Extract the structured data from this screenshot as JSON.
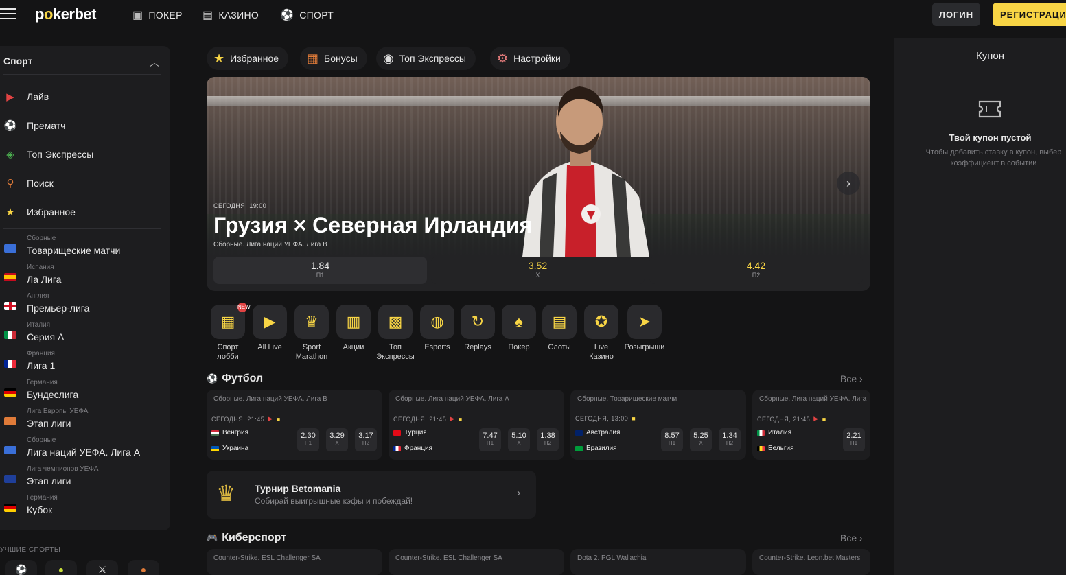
{
  "header": {
    "logo": "pokerbet",
    "nav": [
      {
        "label": "ПОКЕР",
        "icon": "poker-chip-icon"
      },
      {
        "label": "КАЗИНО",
        "icon": "slot-machine-icon"
      },
      {
        "label": "СПОРТ",
        "icon": "soccer-ball-icon"
      }
    ],
    "login": "ЛОГИН",
    "register": "РЕГИСТРАЦИЯ"
  },
  "sidebar": {
    "title": "Спорт",
    "items": [
      {
        "label": "Лайв",
        "icon": "live-play-icon"
      },
      {
        "label": "Прематч",
        "icon": "soccer-ball-icon"
      },
      {
        "label": "Топ Экспрессы",
        "icon": "stack-icon"
      },
      {
        "label": "Поиск",
        "icon": "search-icon"
      },
      {
        "label": "Избранное",
        "icon": "star-icon"
      }
    ],
    "leagues": [
      {
        "category": "Сборные",
        "name": "Товарищеские матчи"
      },
      {
        "category": "Испания",
        "name": "Ла Лига"
      },
      {
        "category": "Англия",
        "name": "Премьер-лига"
      },
      {
        "category": "Италия",
        "name": "Серия А"
      },
      {
        "category": "Франция",
        "name": "Лига 1"
      },
      {
        "category": "Германия",
        "name": "Бундеслига"
      },
      {
        "category": "Лига Европы УЕФА",
        "name": "Этап лиги"
      },
      {
        "category": "Сборные",
        "name": "Лига наций УЕФА. Лига А"
      },
      {
        "category": "Лига чемпионов УЕФА",
        "name": "Этап лиги"
      },
      {
        "category": "Германия",
        "name": "Кубок"
      }
    ],
    "best_sports_title": "УЧШИЕ СПОРТЫ"
  },
  "quick_tabs": [
    {
      "label": "Избранное",
      "icon": "star-icon"
    },
    {
      "label": "Бонусы",
      "icon": "gift-box-icon"
    },
    {
      "label": "Топ Экспрессы",
      "icon": "target-icon"
    },
    {
      "label": "Настройки",
      "icon": "gear-icon"
    }
  ],
  "banner": {
    "date": "СЕГОДНЯ, 19:00",
    "title": "Грузия × Северная Ирландия",
    "subtitle": "Сборные. Лига наций УЕФА. Лига В",
    "odds": [
      {
        "value": "1.84",
        "label": "П1"
      },
      {
        "value": "3.52",
        "label": "Х"
      },
      {
        "value": "4.42",
        "label": "П2"
      }
    ]
  },
  "categories": [
    {
      "label": "Спорт лобби",
      "icon": "sport-lobby-icon",
      "badge": "NEW"
    },
    {
      "label": "All Live",
      "icon": "play-icon"
    },
    {
      "label": "Sport Marathon",
      "icon": "trophy-icon"
    },
    {
      "label": "Акции",
      "icon": "gift-icon"
    },
    {
      "label": "Топ Экспрессы",
      "icon": "express-150-icon"
    },
    {
      "label": "Esports",
      "icon": "gamepad-icon"
    },
    {
      "label": "Replays",
      "icon": "replay-icon"
    },
    {
      "label": "Покер",
      "icon": "poker-cards-icon"
    },
    {
      "label": "Слоты",
      "icon": "slots-icon"
    },
    {
      "label": "Live Казино",
      "icon": "roulette-icon"
    },
    {
      "label": "Розыгрыши",
      "icon": "paper-plane-icon"
    }
  ],
  "football": {
    "title": "Футбол",
    "all": "Все",
    "matches": [
      {
        "league": "Сборные. Лига наций УЕФА. Лига В",
        "time": "СЕГОДНЯ, 21:45",
        "team1": "Венгрия",
        "team2": "Украина",
        "odds": [
          {
            "v": "2.30",
            "l": "П1"
          },
          {
            "v": "3.29",
            "l": "Х"
          },
          {
            "v": "3.17",
            "l": "П2"
          }
        ]
      },
      {
        "league": "Сборные. Лига наций УЕФА. Лига А",
        "time": "СЕГОДНЯ, 21:45",
        "team1": "Турция",
        "team2": "Франция",
        "odds": [
          {
            "v": "7.47",
            "l": "П1"
          },
          {
            "v": "5.10",
            "l": "Х"
          },
          {
            "v": "1.38",
            "l": "П2"
          }
        ]
      },
      {
        "league": "Сборные. Товарищеские матчи",
        "time": "СЕГОДНЯ, 13:00",
        "team1": "Австралия",
        "team2": "Бразилия",
        "odds": [
          {
            "v": "8.57",
            "l": "П1"
          },
          {
            "v": "5.25",
            "l": "Х"
          },
          {
            "v": "1.34",
            "l": "П2"
          }
        ]
      },
      {
        "league": "Сборные. Лига наций УЕФА. Лига",
        "time": "СЕГОДНЯ, 21:45",
        "team1": "Италия",
        "team2": "Бельгия",
        "odds": [
          {
            "v": "2.21",
            "l": "П1"
          }
        ]
      }
    ]
  },
  "tournament": {
    "title": "Турнир Betomania",
    "subtitle": "Собирай выигрышные кэфы и побеждай!"
  },
  "esports": {
    "title": "Киберспорт",
    "all": "Все",
    "matches": [
      {
        "league": "Counter-Strike. ESL Challenger SA"
      },
      {
        "league": "Counter-Strike. ESL Challenger SA"
      },
      {
        "league": "Dota 2. PGL Wallachia"
      },
      {
        "league": "Counter-Strike. Leon.bet Masters"
      }
    ]
  },
  "coupon": {
    "title": "Купон",
    "empty_title": "Твой купон пустой",
    "empty_text": "Чтобы добавить ставку в купон, выбер коэффициент в событии"
  },
  "colors": {
    "accent": "#f8d545",
    "background": "#141415",
    "panel": "#1d1d1f",
    "live": "#e24343"
  }
}
